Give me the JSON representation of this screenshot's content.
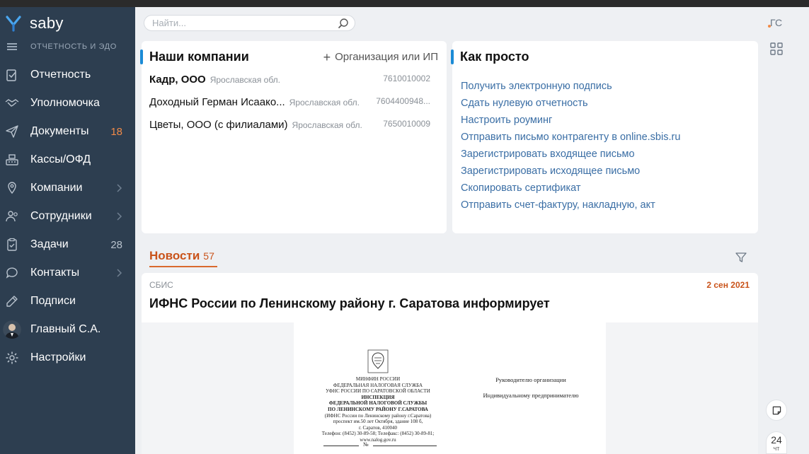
{
  "app": {
    "logo_text": "saby",
    "section_label": "ОТЧЕТНОСТЬ И ЭДО",
    "user_initials": "ГС"
  },
  "search": {
    "placeholder": "Найти..."
  },
  "sidebar": {
    "items": [
      {
        "label": "Отчетность",
        "icon": "report-icon"
      },
      {
        "label": "Уполномочка",
        "icon": "handshake-icon"
      },
      {
        "label": "Документы",
        "icon": "paper-plane-icon",
        "count": "18"
      },
      {
        "label": "Кассы/ОФД",
        "icon": "cash-register-icon"
      },
      {
        "label": "Компании",
        "icon": "map-pin-icon",
        "has_submenu": true
      },
      {
        "label": "Сотрудники",
        "icon": "people-icon",
        "has_submenu": true
      },
      {
        "label": "Задачи",
        "icon": "task-icon",
        "count": "28"
      },
      {
        "label": "Контакты",
        "icon": "chat-icon",
        "has_submenu": true
      },
      {
        "label": "Подписи",
        "icon": "signature-icon"
      },
      {
        "label": "Главный С.А.",
        "icon": "avatar"
      },
      {
        "label": "Настройки",
        "icon": "gear-icon"
      }
    ]
  },
  "companies": {
    "title": "Наши компании",
    "add_label": "Организация или ИП",
    "rows": [
      {
        "name": "Кадр, ООО",
        "region": "Ярославская обл.",
        "inn": "7610010002"
      },
      {
        "name": "Доходный Герман Исаако...",
        "region": "Ярославская обл.",
        "inn": "7604400948..."
      },
      {
        "name": "Цветы, ООО (с филиалами)",
        "region": "Ярославская обл.",
        "inn": "7650010009"
      }
    ]
  },
  "howto": {
    "title": "Как просто",
    "links": [
      "Получить электронную подпись",
      "Сдать нулевую отчетность",
      "Настроить роуминг",
      "Отправить письмо контрагенту в online.sbis.ru",
      "Зарегистрировать входящее письмо",
      "Зарегистрировать исходящее письмо",
      "Скопировать сертификат",
      "Отправить счет-фактуру, накладную, акт"
    ]
  },
  "news": {
    "tab_label": "Новости",
    "count": "57",
    "item": {
      "source": "СБИС",
      "date": "2 сен 2021",
      "title": "ИФНС России по Ленинскому району г. Саратова информирует",
      "document": {
        "left_lines": [
          "МИНФИН РОССИИ",
          "ФЕДЕРАЛЬНАЯ НАЛОГОВАЯ СЛУЖБА",
          "УФНС РОССИИ ПО САРАТОВСКОЙ ОБЛАСТИ",
          "ИНСПЕКЦИЯ",
          "ФЕДЕРАЛЬНОЙ НАЛОГОВОЙ СЛУЖБЫ",
          "ПО ЛЕНИНСКОМУ РАЙОНУ Г.САРАТОВА",
          "(ИФНС России по Ленинскому району г.Саратова)",
          "проспект им.50 лет Октября, здание 108 б,",
          "г. Саратов, 410040",
          "Телефон: (8452) 30-89-58; Телефакс: (8452) 30-89-81;",
          "www.nalog.gov.ru"
        ],
        "right_lines": [
          "Руководителю организации",
          "Индивидуальному предпринимателю"
        ],
        "number_line": "№"
      }
    }
  },
  "calendar": {
    "day": "24",
    "weekday": "чт"
  },
  "colors": {
    "sidebar_bg": "#2d3e50",
    "accent_orange": "#c9531a",
    "link_blue": "#3a6ea5",
    "marker_blue": "#1b8bd6"
  }
}
